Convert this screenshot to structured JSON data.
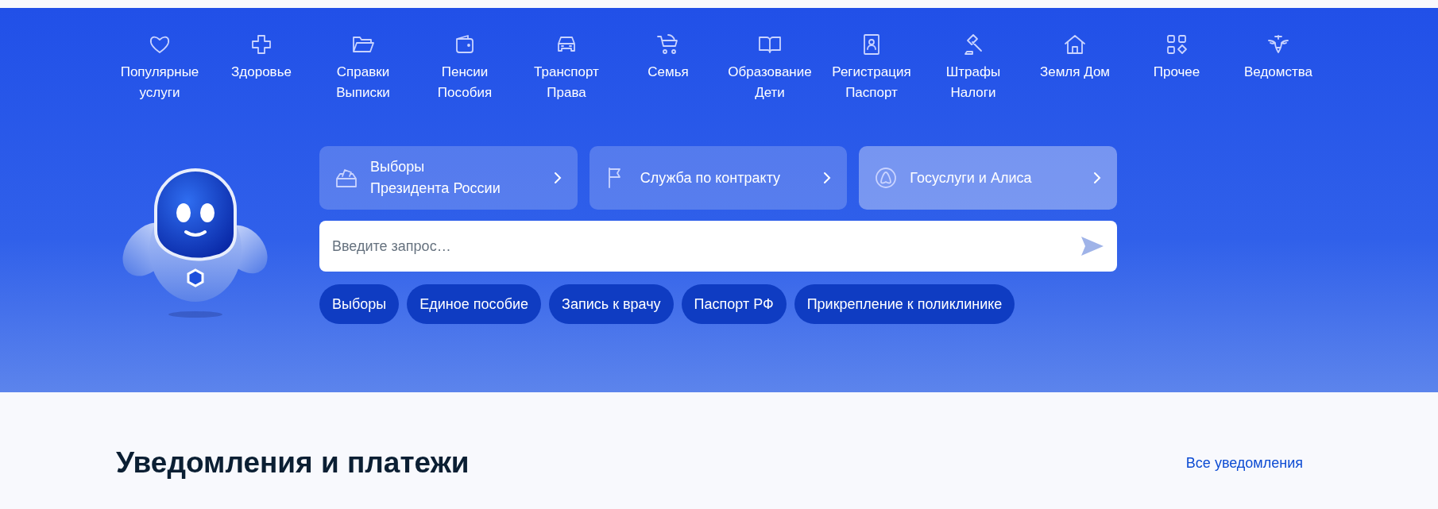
{
  "categories": [
    {
      "label": "Популярные\nуслуги"
    },
    {
      "label": "Здоровье"
    },
    {
      "label": "Справки\nВыписки"
    },
    {
      "label": "Пенсии\nПособия"
    },
    {
      "label": "Транспорт\nПрава"
    },
    {
      "label": "Семья"
    },
    {
      "label": "Образование\nДети"
    },
    {
      "label": "Регистрация\nПаспорт"
    },
    {
      "label": "Штрафы\nНалоги"
    },
    {
      "label": "Земля Дом"
    },
    {
      "label": "Прочее"
    },
    {
      "label": "Ведомства"
    }
  ],
  "promo_cards": [
    {
      "title": "Выборы\nПрезидента России",
      "highlighted": false
    },
    {
      "title": "Служба по контракту",
      "highlighted": false
    },
    {
      "title": "Госуслуги и Алиса",
      "highlighted": true
    }
  ],
  "search": {
    "placeholder": "Введите запрос…"
  },
  "quick_chips": [
    "Выборы",
    "Единое пособие",
    "Запись к врачу",
    "Паспорт РФ",
    "Прикрепление к поликлинике"
  ],
  "notifications": {
    "heading": "Уведомления и платежи",
    "link": "Все уведомления"
  }
}
